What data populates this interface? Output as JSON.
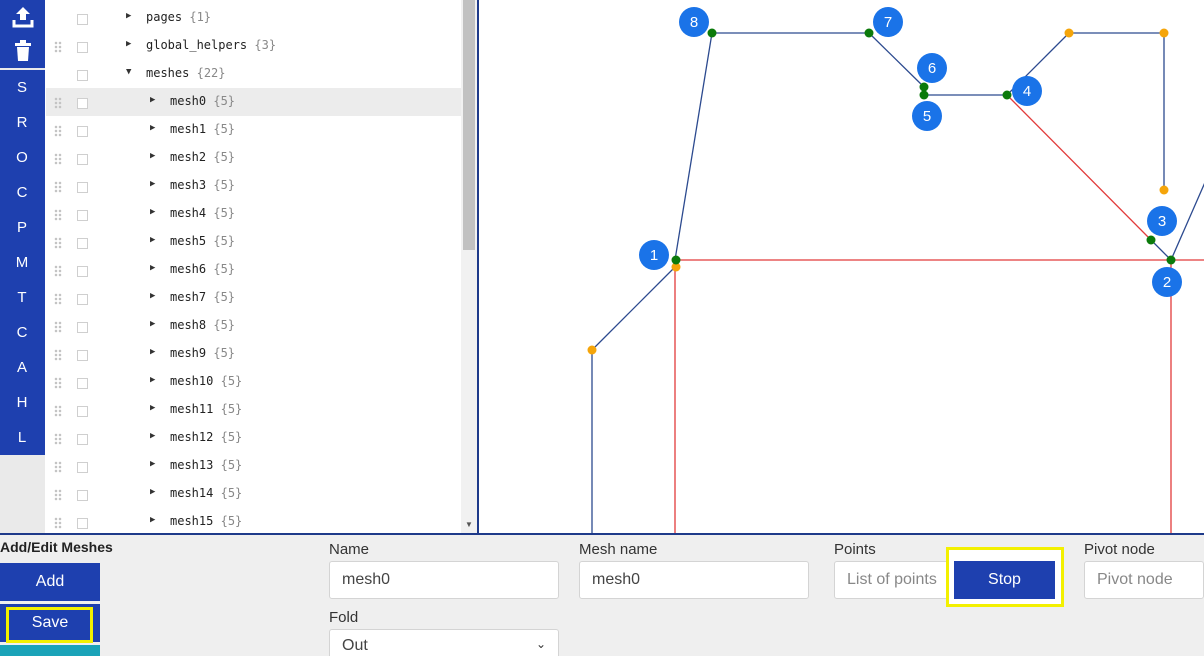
{
  "toolbar": {
    "upload_icon": "upload-icon",
    "trash_icon": "trash-icon",
    "letters": [
      "S",
      "R",
      "O",
      "C",
      "P",
      "M",
      "T",
      "C",
      "A",
      "H",
      "L"
    ]
  },
  "tree": {
    "rows": [
      {
        "label": "pages",
        "count": "{1}",
        "expanded": false,
        "depth": 0
      },
      {
        "label": "global_helpers",
        "count": "{3}",
        "expanded": false,
        "depth": 0
      },
      {
        "label": "meshes",
        "count": "{22}",
        "expanded": true,
        "depth": 0
      },
      {
        "label": "mesh0",
        "count": "{5}",
        "expanded": false,
        "depth": 1,
        "selected": true
      },
      {
        "label": "mesh1",
        "count": "{5}",
        "expanded": false,
        "depth": 1
      },
      {
        "label": "mesh2",
        "count": "{5}",
        "expanded": false,
        "depth": 1
      },
      {
        "label": "mesh3",
        "count": "{5}",
        "expanded": false,
        "depth": 1
      },
      {
        "label": "mesh4",
        "count": "{5}",
        "expanded": false,
        "depth": 1
      },
      {
        "label": "mesh5",
        "count": "{5}",
        "expanded": false,
        "depth": 1
      },
      {
        "label": "mesh6",
        "count": "{5}",
        "expanded": false,
        "depth": 1
      },
      {
        "label": "mesh7",
        "count": "{5}",
        "expanded": false,
        "depth": 1
      },
      {
        "label": "mesh8",
        "count": "{5}",
        "expanded": false,
        "depth": 1
      },
      {
        "label": "mesh9",
        "count": "{5}",
        "expanded": false,
        "depth": 1
      },
      {
        "label": "mesh10",
        "count": "{5}",
        "expanded": false,
        "depth": 1
      },
      {
        "label": "mesh11",
        "count": "{5}",
        "expanded": false,
        "depth": 1
      },
      {
        "label": "mesh12",
        "count": "{5}",
        "expanded": false,
        "depth": 1
      },
      {
        "label": "mesh13",
        "count": "{5}",
        "expanded": false,
        "depth": 1
      },
      {
        "label": "mesh14",
        "count": "{5}",
        "expanded": false,
        "depth": 1
      },
      {
        "label": "mesh15",
        "count": "{5}",
        "expanded": false,
        "depth": 1
      }
    ]
  },
  "canvas": {
    "node_numbers": [
      "1",
      "2",
      "3",
      "4",
      "5",
      "6",
      "7",
      "8"
    ],
    "colors": {
      "line_blue": "#2c4a8f",
      "line_red": "#e23b3b",
      "point_green": "#0b7a0b",
      "point_orange": "#f5a50a",
      "badge": "#1a73e8"
    }
  },
  "form": {
    "title": "Add/Edit Meshes",
    "add_label": "Add",
    "save_label": "Save",
    "name_label": "Name",
    "name_value": "mesh0",
    "mesh_name_label": "Mesh name",
    "mesh_name_value": "mesh0",
    "points_label": "Points",
    "points_placeholder": "List of points",
    "stop_label": "Stop",
    "pivot_label": "Pivot node",
    "pivot_placeholder": "Pivot node",
    "fold_label": "Fold",
    "fold_value": "Out"
  },
  "colors": {
    "accent": "#1e40af",
    "highlight": "#f3f000"
  }
}
